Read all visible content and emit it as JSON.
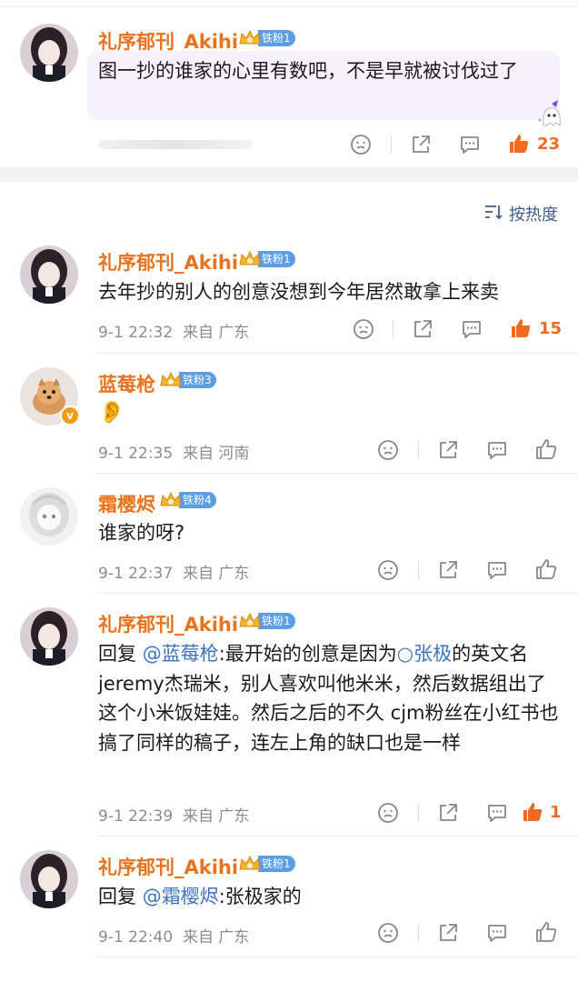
{
  "sort": {
    "label": "按热度"
  },
  "comments": [
    {
      "user": "礼序郁刊_Akihi",
      "fan_level": "铁粉1",
      "text": "图一抄的谁家的心里有数吧，不是早就被讨伐过了",
      "likes": "23"
    },
    {
      "user": "礼序郁刊_Akihi",
      "fan_level": "铁粉1",
      "text": "去年抄的别人的创意没想到今年居然敢拿上来卖",
      "time": "9-1 22:32",
      "location": "来自 广东",
      "likes": "15"
    },
    {
      "user": "蓝莓枪",
      "fan_level": "铁粉3",
      "text": "👂",
      "time": "9-1 22:35",
      "location": "来自 河南"
    },
    {
      "user": "霜樱烬",
      "fan_level": "铁粉4",
      "text": "谁家的呀?",
      "time": "9-1 22:37",
      "location": "来自 广东"
    },
    {
      "user": "礼序郁刊_Akihi",
      "fan_level": "铁粉1",
      "reply_prefix": "回复 ",
      "reply_to": "@蓝莓枪",
      "text_a": ":最开始的创意是因为",
      "topic": "○张极",
      "text_b": "的英文名jeremy杰瑞米，别人喜欢叫他米米，然后数据组出了这个小米饭娃娃。然后之后的不久 cjm粉丝在小红书也搞了同样的稿子，连左上角的缺口也是一样",
      "time": "9-1 22:39",
      "location": "来自 广东",
      "likes": "1"
    },
    {
      "user": "礼序郁刊_Akihi",
      "fan_level": "铁粉1",
      "reply_prefix": "回复 ",
      "reply_to": "@霜樱烬",
      "text": ":张极家的",
      "time": "9-1 22:40",
      "location": "来自 广东"
    }
  ],
  "colors": {
    "name": "#e8731f",
    "mention": "#3e73c2",
    "like_active": "#f06a22",
    "fan_tag": "#5b9ee6"
  }
}
